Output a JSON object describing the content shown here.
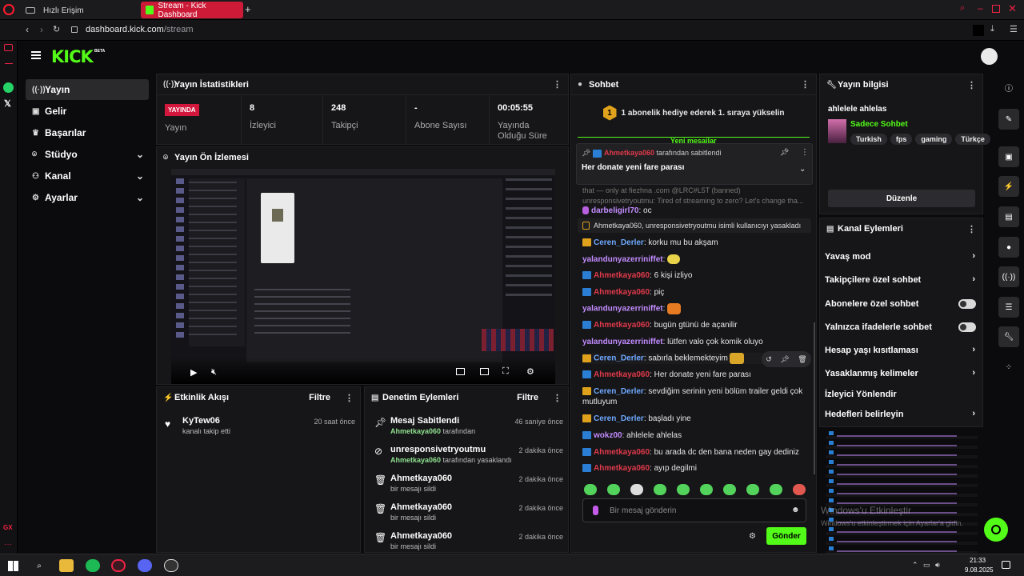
{
  "browser": {
    "tabs": [
      {
        "label": "Hızlı Erişim"
      },
      {
        "label": "Stream - Kick Dashboard"
      }
    ],
    "url_domain": "dashboard.kick.com",
    "url_path": "/stream"
  },
  "brand": {
    "logo": "KICK",
    "beta": "BETA",
    "accent": "#53fc18"
  },
  "nav": [
    {
      "label": "Yayın",
      "icon": "broadcast-icon",
      "active": true
    },
    {
      "label": "Gelir",
      "icon": "wallet-icon"
    },
    {
      "label": "Başarılar",
      "icon": "trophy-icon"
    },
    {
      "label": "Stüdyo",
      "icon": "studio-icon",
      "expandable": true
    },
    {
      "label": "Kanal",
      "icon": "channel-icon",
      "expandable": true
    },
    {
      "label": "Ayarlar",
      "icon": "gear-icon",
      "expandable": true
    }
  ],
  "stats": {
    "title": "Yayın İstatistikleri",
    "live_badge": "YAYINDA",
    "live_label": "Yayın",
    "viewers_value": "8",
    "viewers_label": "İzleyici",
    "followers_value": "248",
    "followers_label": "Takipçi",
    "subs_value": "-",
    "subs_label": "Abone Sayısı",
    "uptime_value": "00:05:55",
    "uptime_label": "Yayında Olduğu Süre"
  },
  "preview": {
    "title": "Yayın Ön İzlemesi"
  },
  "activity": {
    "title": "Etkinlik Akışı",
    "filter": "Filtre",
    "items": [
      {
        "user": "KyTew06",
        "action": "kanalı takip etti",
        "time": "20 saat önce"
      }
    ]
  },
  "moderation": {
    "title": "Denetim Eylemleri",
    "filter": "Filtre",
    "items": [
      {
        "title": "Mesaj Sabitlendi",
        "actor": "Ahmetkaya060",
        "rest": " tarafından",
        "time": "46 saniye önce"
      },
      {
        "title": "unresponsivetryoutmu",
        "actor": "Ahmetkaya060",
        "rest": " tarafından yasaklandı",
        "time": "2 dakika önce"
      },
      {
        "title": "Ahmetkaya060",
        "actor": "",
        "rest": "bir mesajı sildi",
        "time": "2 dakika önce"
      },
      {
        "title": "Ahmetkaya060",
        "actor": "",
        "rest": "bir mesajı sildi",
        "time": "2 dakika önce"
      },
      {
        "title": "Ahmetkaya060",
        "actor": "",
        "rest": "bir mesajı sildi",
        "time": "2 dakika önce"
      }
    ]
  },
  "chat": {
    "title": "Sohbet",
    "gift_banner": "1 abonelik hediye ederek 1. sıraya yükselin",
    "new_messages": "Yeni mesajlar",
    "pinned_by_user": "Ahmetkaya060",
    "pinned_by_text": " tarafından sabitlendi",
    "pinned_message": "Her donate yeni fare parası",
    "faded_1": "that — only at fiezhna .com @LRC#L5T (banned)",
    "faded_2": "unresponsivetryoutmu: Tired of streaming to zero? Let's change tha...",
    "ban_notice": "Ahmetkaya060, unresponsivetryoutmu isimli kullanıcıyı yasakladı",
    "messages": [
      {
        "user": "darbeligirl70",
        "text": ": oc",
        "color": "u-pur",
        "badge": "mic"
      },
      {
        "user": "Ceren_Derler",
        "text": ": korku mu bu akşam",
        "color": "u-pur",
        "badge": "c"
      },
      {
        "user": "yalandunyazerriniffet",
        "text": ":",
        "color": "u-pur",
        "badge": ""
      },
      {
        "user": "Ahmetkaya060",
        "text": ": 6 kişi izliyo",
        "color": "u-red",
        "badge": "k"
      },
      {
        "user": "Ahmetkaya060",
        "text": ": piç",
        "color": "u-red",
        "badge": "k"
      },
      {
        "user": "yalandunyazerriniffet",
        "text": ":",
        "color": "u-pur",
        "badge": ""
      },
      {
        "user": "Ahmetkaya060",
        "text": ": bugün gtünü de açanilir",
        "color": "u-red",
        "badge": "k"
      },
      {
        "user": "yalandunyazerriniffet",
        "text": ": lütfen valo çok komik oluyo",
        "color": "u-pur",
        "badge": ""
      },
      {
        "user": "Ceren_Derler",
        "text": ": sabırla beklemekteyim",
        "color": "u-pur",
        "badge": "c"
      },
      {
        "user": "Ahmetkaya060",
        "text": ": Her donate yeni fare parası",
        "color": "u-red",
        "badge": "k"
      },
      {
        "user": "Ceren_Derler",
        "text": ": sevdiğim serinin yeni bölüm trailer geldi çok mutluyum",
        "color": "u-pur",
        "badge": "c"
      },
      {
        "user": "Ceren_Derler",
        "text": ": başladı yine",
        "color": "u-pur",
        "badge": "c"
      },
      {
        "user": "wokz00",
        "text": ": ahlelele ahlelas",
        "color": "u-pur",
        "badge": "k"
      },
      {
        "user": "Ahmetkaya060",
        "text": ": bu arada dc den bana neden gay dediniz",
        "color": "u-red",
        "badge": "k"
      },
      {
        "user": "Ahmetkaya060",
        "text": ": ayıp degilmi",
        "color": "u-red",
        "badge": "k"
      }
    ],
    "input_placeholder": "Bir mesaj gönderin",
    "send": "Gönder"
  },
  "stream_info": {
    "title": "Yayın bilgisi",
    "stream_title": "ahlelele ahlelas",
    "category": "Sadece Sohbet",
    "tags": [
      "Turkish",
      "fps",
      "gaming",
      "Türkçe"
    ],
    "edit": "Düzenle"
  },
  "channel_actions": {
    "title": "Kanal Eylemleri",
    "items": [
      {
        "label": "Yavaş mod",
        "control": "chevron"
      },
      {
        "label": "Takipçilere özel sohbet",
        "control": "chevron"
      },
      {
        "label": "Abonelere özel sohbet",
        "control": "toggle"
      },
      {
        "label": "Yalnızca ifadelerle sohbet",
        "control": "toggle"
      },
      {
        "label": "Hesap yaşı kısıtlaması",
        "control": "chevron"
      },
      {
        "label": "Yasaklanmış kelimeler",
        "control": "chevron"
      },
      {
        "label": "İzleyici Yönlendir",
        "control": "none"
      },
      {
        "label": "Hedefleri belirleyin",
        "control": "chevron"
      }
    ]
  },
  "overlay": {
    "windows_1": "Windows'u Etkinleştir",
    "windows_2": "Windows'u etkinleştirmek için Ayarlar'a gidin."
  },
  "taskbar": {
    "time": "21:33",
    "date": "9.08.2025"
  }
}
